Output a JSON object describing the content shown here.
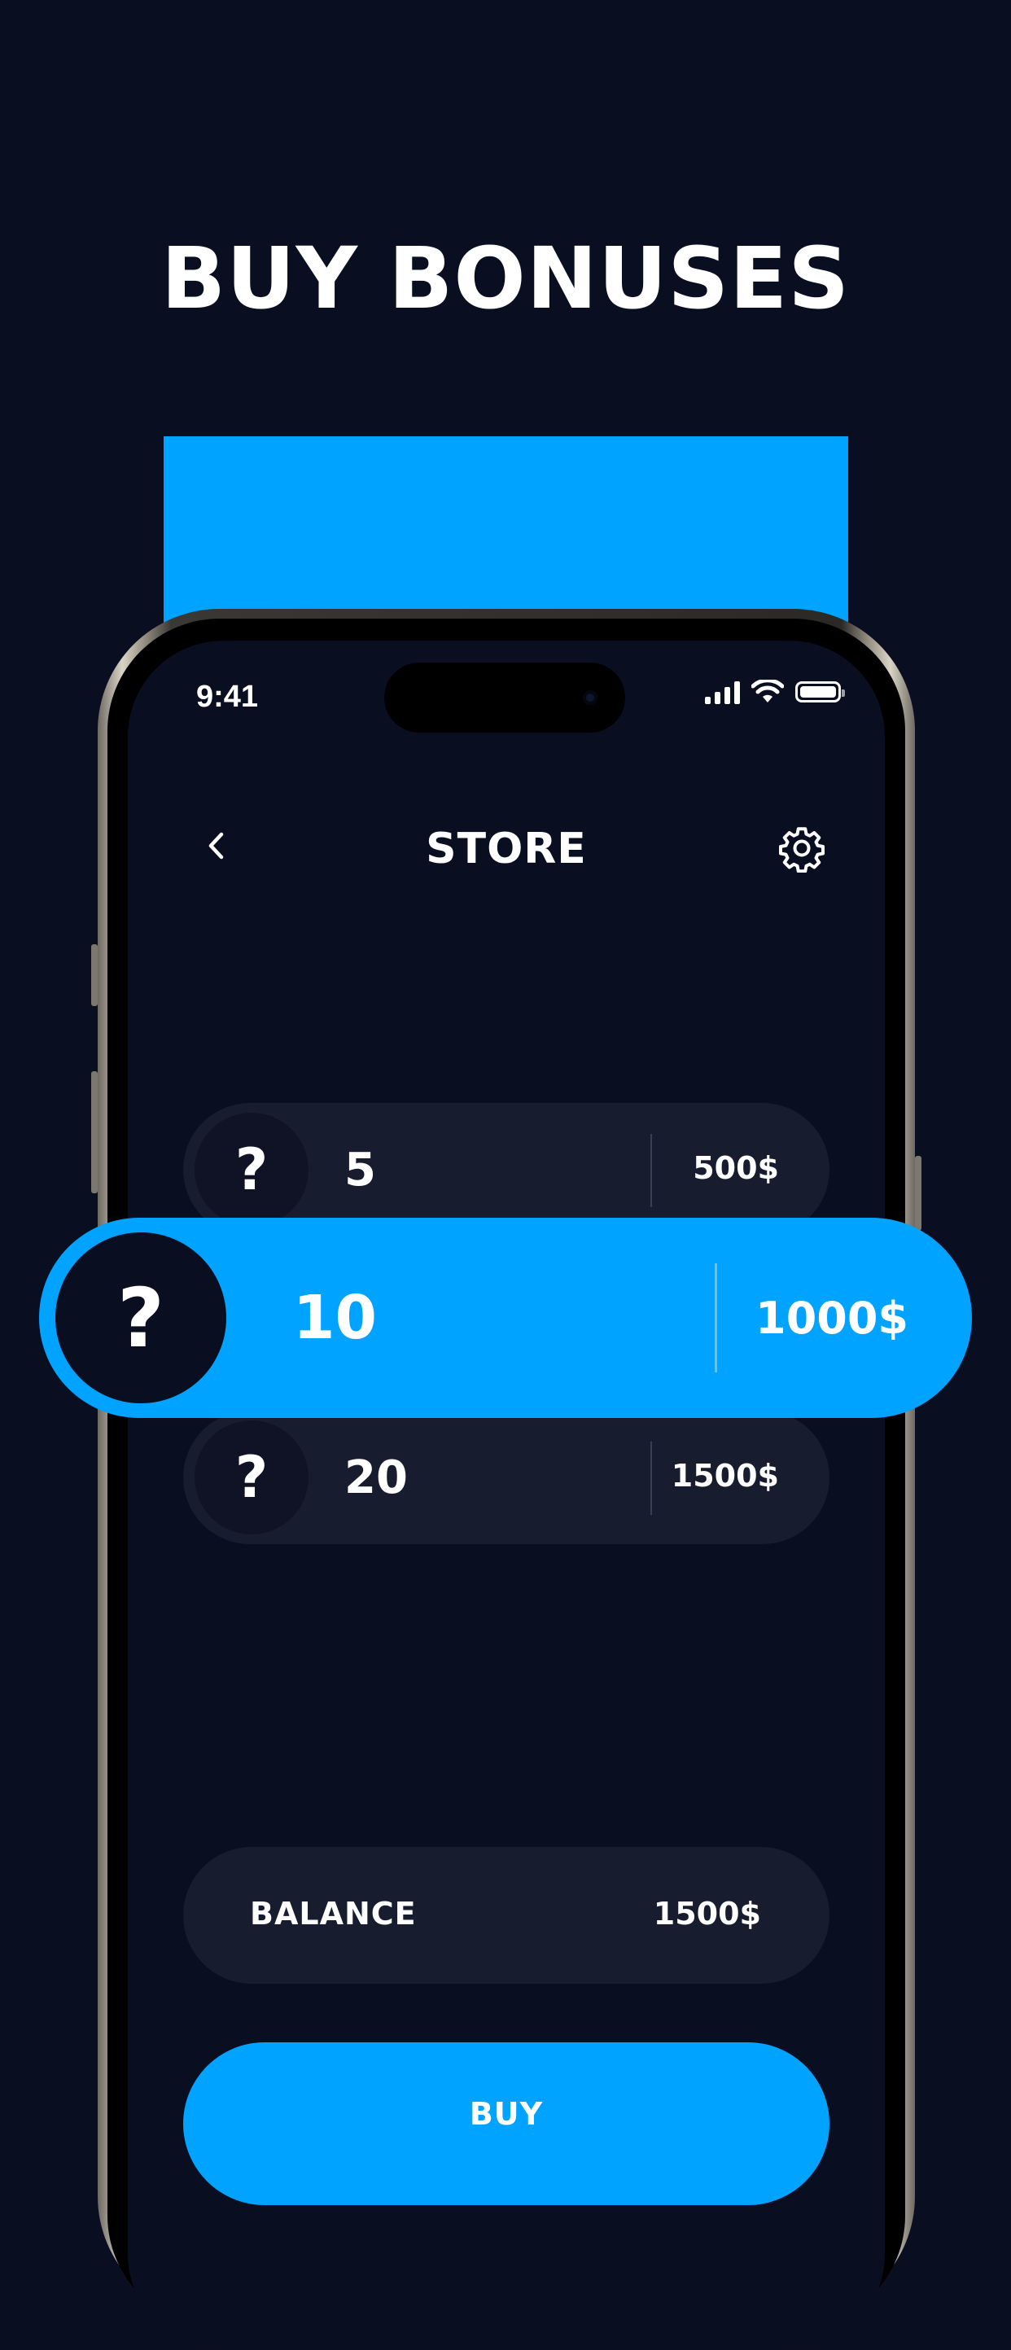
{
  "headline": "BUY BONUSES",
  "colors": {
    "background": "#0a0e21",
    "accent": "#00a3ff",
    "card": "#181c2f"
  },
  "status_bar": {
    "time": "9:41",
    "icons": [
      "cellular-signal-icon",
      "wifi-icon",
      "battery-icon"
    ]
  },
  "nav": {
    "title": "STORE",
    "back_icon": "chevron-left-icon",
    "settings_icon": "gear-icon"
  },
  "items": [
    {
      "icon": "question-mark-icon",
      "symbol": "?",
      "quantity": "5",
      "price": "500$",
      "selected": false
    },
    {
      "icon": "question-mark-icon",
      "symbol": "?",
      "quantity": "10",
      "price": "1000$",
      "selected": true
    },
    {
      "icon": "question-mark-icon",
      "symbol": "?",
      "quantity": "20",
      "price": "1500$",
      "selected": false
    }
  ],
  "balance": {
    "label": "BALANCE",
    "value": "1500$"
  },
  "buy_button": {
    "label": "BUY"
  }
}
